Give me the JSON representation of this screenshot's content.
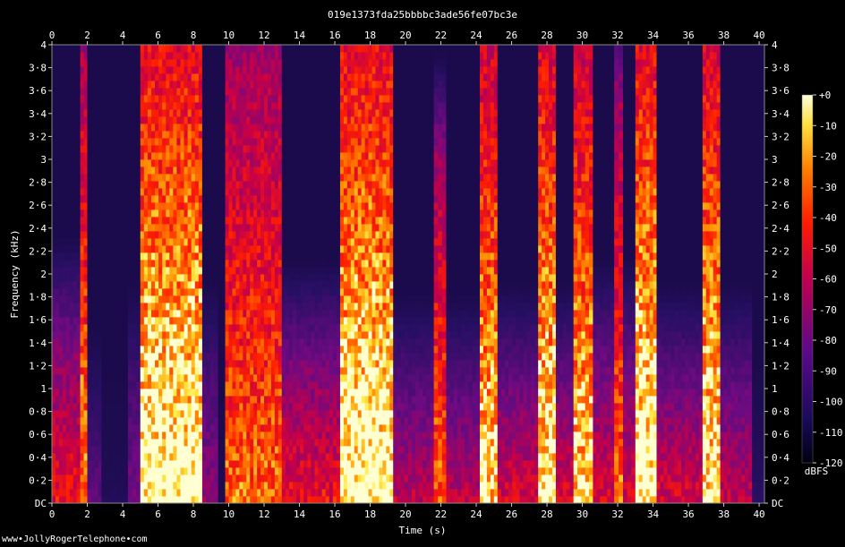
{
  "chart_data": {
    "type": "heatmap",
    "title": "019e1373fda25bbbbc3ade56fe07bc3e",
    "xlabel": "Time (s)",
    "ylabel": "Frequency (kHz)",
    "xlim": [
      0,
      40.3
    ],
    "ylim": [
      0,
      4
    ],
    "x_ticks": [
      "0",
      "2",
      "4",
      "6",
      "8",
      "10",
      "12",
      "14",
      "16",
      "18",
      "20",
      "22",
      "24",
      "26",
      "28",
      "30",
      "32",
      "34",
      "36",
      "38",
      "40"
    ],
    "y_ticks": [
      "DC",
      "0·2",
      "0·4",
      "0·6",
      "0·8",
      "1",
      "1·2",
      "1·4",
      "1·6",
      "1·8",
      "2",
      "2·2",
      "2·4",
      "2·6",
      "2·8",
      "3",
      "3·2",
      "3·4",
      "3·6",
      "3·8",
      "4"
    ],
    "y_tick_values": [
      0,
      0.2,
      0.4,
      0.6,
      0.8,
      1,
      1.2,
      1.4,
      1.6,
      1.8,
      2,
      2.2,
      2.4,
      2.6,
      2.8,
      3,
      3.2,
      3.4,
      3.6,
      3.8,
      4
    ],
    "colorbar": {
      "label": "dBFS",
      "ticks": [
        "+0",
        "-10",
        "-20",
        "-30",
        "-40",
        "-50",
        "-60",
        "-70",
        "-80",
        "-90",
        "-100",
        "-110",
        "-120"
      ],
      "range": [
        -120,
        0
      ]
    },
    "colors": {
      "background": "#000000",
      "low": "#0a0a3a",
      "mid": "#8a0a8a",
      "high": "#ff2000",
      "peak": "#ffff60"
    },
    "segments": [
      {
        "start": 0.0,
        "end": 1.6,
        "level": 0.55,
        "top": 1.4
      },
      {
        "start": 1.6,
        "end": 2.0,
        "level": 0.75,
        "top": 3.9
      },
      {
        "start": 2.0,
        "end": 2.8,
        "level": 0.25,
        "top": 0.6
      },
      {
        "start": 2.8,
        "end": 4.3,
        "level": 0.05,
        "top": 0.2
      },
      {
        "start": 4.3,
        "end": 5.0,
        "level": 0.3,
        "top": 1.0
      },
      {
        "start": 5.0,
        "end": 8.5,
        "level": 0.95,
        "top": 4.0
      },
      {
        "start": 8.5,
        "end": 9.4,
        "level": 0.35,
        "top": 1.0
      },
      {
        "start": 9.4,
        "end": 9.8,
        "level": 0.02,
        "top": 0.1
      },
      {
        "start": 9.8,
        "end": 13.0,
        "level": 0.7,
        "top": 3.9
      },
      {
        "start": 13.0,
        "end": 16.3,
        "level": 0.55,
        "top": 1.2
      },
      {
        "start": 16.3,
        "end": 19.3,
        "level": 0.95,
        "top": 4.0
      },
      {
        "start": 19.3,
        "end": 21.6,
        "level": 0.45,
        "top": 0.9
      },
      {
        "start": 21.6,
        "end": 22.3,
        "level": 0.7,
        "top": 3.0
      },
      {
        "start": 22.3,
        "end": 24.2,
        "level": 0.45,
        "top": 0.9
      },
      {
        "start": 24.2,
        "end": 25.2,
        "level": 0.85,
        "top": 4.0
      },
      {
        "start": 25.2,
        "end": 27.5,
        "level": 0.5,
        "top": 1.0
      },
      {
        "start": 27.5,
        "end": 28.5,
        "level": 0.9,
        "top": 4.0
      },
      {
        "start": 28.5,
        "end": 29.5,
        "level": 0.5,
        "top": 1.0
      },
      {
        "start": 29.5,
        "end": 30.6,
        "level": 0.85,
        "top": 4.0
      },
      {
        "start": 30.6,
        "end": 31.8,
        "level": 0.5,
        "top": 1.2
      },
      {
        "start": 31.8,
        "end": 32.3,
        "level": 0.7,
        "top": 3.5
      },
      {
        "start": 32.3,
        "end": 33.0,
        "level": 0.5,
        "top": 1.2
      },
      {
        "start": 33.0,
        "end": 34.2,
        "level": 0.95,
        "top": 4.0
      },
      {
        "start": 34.2,
        "end": 36.8,
        "level": 0.5,
        "top": 1.0
      },
      {
        "start": 36.8,
        "end": 37.8,
        "level": 0.9,
        "top": 4.0
      },
      {
        "start": 37.8,
        "end": 39.6,
        "level": 0.45,
        "top": 1.0
      },
      {
        "start": 39.6,
        "end": 40.3,
        "level": 0.1,
        "top": 0.3
      }
    ]
  },
  "footer": {
    "site": "www•JollyRogerTelephone•com"
  }
}
